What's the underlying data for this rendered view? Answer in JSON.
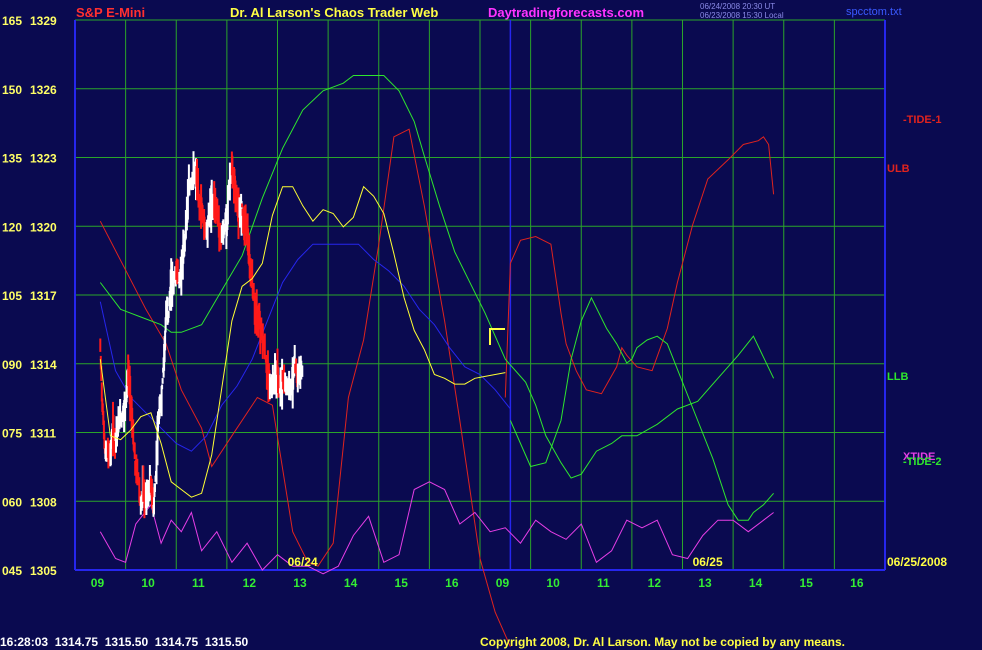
{
  "header": {
    "symbol": "S&P E-Mini",
    "title": "Dr. Al Larson's Chaos Trader Web",
    "site": "Daytradingforecasts.com",
    "ts1": "06/24/2008 20:30 UT",
    "ts2": "06/23/2008 15:30 Local",
    "file": "spcctom.txt"
  },
  "footer": {
    "quote": "16:28:03  1314.75  1315.50  1314.75  1315.50",
    "copyright": "Copyright 2008, Dr. Al Larson. May not be copied by any means."
  },
  "colors": {
    "bg": "#0a0a50",
    "grid": "#2aa52a",
    "price": "#ffffff",
    "price_red": "#ff1a1a",
    "ma": "#ffff33",
    "red": "#e0231e",
    "green": "#2ee62e",
    "blue": "#2626ee",
    "magenta": "#e63ee6",
    "yellow": "#ffff44",
    "axis_text": "#ffff66"
  },
  "chart_data": {
    "type": "line",
    "title": "S&P E-Mini",
    "y_left_osc_ticks": [
      "165",
      "150",
      "135",
      "120",
      "105",
      "090",
      "075",
      "060",
      "045"
    ],
    "y_left_price_ticks": [
      "1329",
      "1326",
      "1323",
      "1320",
      "1317",
      "1314",
      "1311",
      "1308",
      "1305"
    ],
    "ylim": [
      1305,
      1329
    ],
    "x_ticks": [
      "09",
      "10",
      "11",
      "12",
      "13",
      "14",
      "15",
      "16",
      "09",
      "10",
      "11",
      "12",
      "13",
      "14",
      "15",
      "16"
    ],
    "date_markers": [
      "06/24",
      "06/25",
      "06/25/2008"
    ],
    "right_labels": [
      "-TIDE-1",
      "ULB",
      "LLB",
      "XTIDE",
      "-TIDE-2"
    ],
    "price_series": {
      "name": "S&P E-Mini",
      "x": [
        0,
        0.5,
        1,
        1.5,
        2,
        2.5,
        3,
        3.5,
        4,
        4.5,
        5,
        5.5,
        6,
        6.5,
        7,
        7.5,
        8,
        8.5,
        9,
        9.5,
        10,
        10.5,
        11,
        11.5,
        12,
        12.5,
        13,
        13.5,
        14,
        14.5,
        15,
        15.5,
        16,
        16.5,
        17,
        17.5,
        18,
        18.5,
        19,
        19.5,
        20,
        20.5,
        21,
        21.5,
        22,
        22.5,
        23,
        23.5,
        24,
        24.5,
        25,
        25.5,
        26,
        26.5,
        27,
        27.5,
        28,
        28.5,
        29,
        29.5,
        30,
        30.5,
        31,
        31.5,
        32,
        32.5,
        33,
        33.5,
        34,
        34.5,
        35,
        35.5,
        36,
        36.5,
        37,
        37.5,
        38,
        38.5,
        39,
        39.5,
        40,
        40.5,
        41,
        41.5,
        42,
        42.5,
        43,
        43.5,
        44,
        44.5,
        45,
        45.5,
        46,
        46.5,
        47,
        47.5,
        48,
        48.5,
        49,
        49.5,
        50,
        50.5,
        51,
        51.5,
        52,
        52.5,
        53,
        53.5,
        54,
        54.5,
        55,
        55.5,
        56,
        56.5,
        57,
        57.5,
        58,
        58.5,
        59,
        59.5,
        60,
        60.5,
        61,
        61.5,
        62,
        62.5,
        63,
        63.5,
        64,
        64.5,
        65,
        65.5,
        66,
        66.5,
        67,
        67.5,
        68,
        68.5,
        69,
        69.5,
        70,
        70.5,
        71,
        71.5,
        72,
        72.5,
        73,
        73.5,
        74,
        74.5,
        75,
        75.5,
        76,
        76.5,
        77,
        77.5,
        78,
        78.5,
        79,
        79.5,
        80,
        80.5,
        81
      ],
      "values": [
        1316.5,
        1313.2,
        1311.0,
        1311.2,
        1311.1,
        1312.3,
        1312.0,
        1312.4,
        1312.8,
        1313.3,
        1313.6,
        1315.3,
        1313.8,
        1311.8,
        1310.2,
        1309.8,
        1308.4,
        1309.2,
        1308.6,
        1309.0,
        1309.4,
        1308.2,
        1310.0,
        1312.8,
        1313.6,
        1315.8,
        1318.2,
        1318.5,
        1320.0,
        1320.1,
        1320.6,
        1320.0,
        1320.7,
        1321.5,
        1323.5,
        1324.8,
        1325.4,
        1325.5,
        1325.5,
        1324.2,
        1323.9,
        1323.0,
        1322.8,
        1323.6,
        1324.2,
        1324.3,
        1323.8,
        1322.9,
        1322.5,
        1322.6,
        1323.5,
        1325.2,
        1325.7,
        1325.3,
        1324.0,
        1323.4,
        1324.0,
        1323.2,
        1323.1,
        1320.5,
        1320.0,
        1318.8,
        1318.2,
        1317.8,
        1317.2,
        1316.3,
        1315.2,
        1314.6,
        1314.6,
        1315.0,
        1315.3,
        1314.4,
        1315.0,
        1314.5,
        1314.6,
        1314.7,
        1314.9,
        1315.5,
        1315.2,
        1315.3,
        1315.5
      ]
    },
    "series": [
      {
        "name": "-TIDE-1",
        "color": "#e0231e",
        "x": [
          0,
          9,
          13,
          16,
          20,
          22,
          26,
          31,
          34,
          38,
          41,
          43,
          46,
          49,
          52,
          55,
          58,
          61,
          64,
          68,
          71,
          75,
          78,
          81
        ],
        "values": [
          136,
          113,
          104,
          92,
          82,
          72,
          80,
          90,
          88,
          55,
          47,
          46,
          52,
          90,
          105,
          130,
          158,
          160,
          140,
          110,
          84,
          48,
          34,
          25
        ]
      },
      {
        "name": "ULB",
        "color": "#e0231e",
        "x": [
          80,
          81,
          83,
          86,
          89,
          91,
          92,
          94,
          96,
          99,
          102,
          103,
          104,
          106,
          109,
          112,
          114,
          117,
          120,
          124,
          127,
          130,
          131,
          132,
          133
        ],
        "values": [
          90,
          125,
          131,
          132,
          130,
          112,
          104,
          97,
          92,
          91,
          98,
          103,
          101,
          98,
          97,
          108,
          120,
          135,
          147,
          152,
          156,
          157,
          158,
          156,
          143
        ]
      },
      {
        "name": "LLB",
        "color": "#2ee62e",
        "x": [
          0,
          4,
          8,
          12,
          14,
          16,
          20,
          24,
          28,
          32,
          36,
          40,
          44,
          48,
          50,
          53,
          56,
          59,
          62,
          64,
          67,
          70,
          76,
          80,
          84,
          86,
          88,
          91,
          93,
          95,
          98,
          101,
          103,
          106,
          110,
          114,
          118,
          122,
          126,
          129,
          133
        ],
        "values": [
          120,
          113,
          111,
          109,
          107,
          107,
          109,
          118,
          127,
          142,
          155,
          165,
          170,
          172,
          174,
          174,
          174,
          170,
          162,
          153,
          140,
          128,
          112,
          100,
          94,
          88,
          80,
          73,
          69,
          70,
          76,
          78,
          80,
          80,
          83,
          87,
          89,
          95,
          101,
          106,
          95
        ]
      },
      {
        "name": "-TIDE-2",
        "color": "#2ee62e",
        "x": [
          81,
          85,
          88,
          91,
          93,
          95,
          97,
          100,
          102,
          104,
          105,
          106,
          108,
          110,
          112,
          115,
          118,
          121,
          124,
          126,
          128,
          129,
          131,
          133
        ],
        "values": [
          84,
          72,
          73,
          84,
          100,
          110,
          116,
          108,
          104,
          99,
          100,
          103,
          105,
          106,
          104,
          94,
          84,
          74,
          62,
          58,
          58,
          60,
          62,
          65
        ]
      },
      {
        "name": "XTIDE",
        "color": "#e63ee6",
        "x": [
          0,
          3,
          5,
          7,
          10,
          12,
          14,
          16,
          18,
          20,
          23,
          26,
          29,
          32,
          35,
          38,
          41,
          44,
          47,
          50,
          53,
          56,
          59,
          62,
          65,
          68,
          71,
          74,
          77,
          80,
          83,
          86,
          89,
          92,
          95,
          98,
          101,
          104,
          107,
          110,
          113,
          116,
          119,
          122,
          125,
          128,
          131,
          133
        ],
        "values": [
          55,
          48,
          47,
          57,
          62,
          52,
          58,
          55,
          60,
          50,
          55,
          47,
          52,
          45,
          49,
          46,
          46,
          44,
          46,
          54,
          59,
          47,
          49,
          66,
          68,
          66,
          57,
          60,
          55,
          56,
          52,
          58,
          55,
          53,
          57,
          47,
          50,
          58,
          56,
          58,
          49,
          48,
          54,
          58,
          58,
          55,
          58,
          60
        ]
      },
      {
        "name": "blue",
        "color": "#2626ee",
        "x": [
          0,
          3,
          6,
          9,
          12,
          15,
          18,
          21,
          24,
          27,
          30,
          33,
          36,
          39,
          42,
          45,
          48,
          51,
          54,
          57,
          60,
          63,
          66,
          69,
          72,
          75,
          78,
          81
        ],
        "values": [
          115,
          97,
          90,
          86,
          82,
          78,
          76,
          80,
          88,
          93,
          100,
          110,
          120,
          126,
          130,
          130,
          130,
          130,
          126,
          123,
          119,
          113,
          109,
          103,
          98,
          96,
          92,
          87
        ]
      }
    ],
    "ma_series": {
      "name": "ma",
      "x": [
        0,
        2,
        4,
        6,
        8,
        10,
        12,
        14,
        16,
        18,
        20,
        22,
        24,
        26,
        28,
        30,
        32,
        34,
        36,
        38,
        40,
        42,
        44,
        46,
        48,
        50,
        52,
        54,
        56,
        58,
        60,
        62,
        64,
        66,
        68,
        70,
        72,
        74,
        76,
        78,
        80
      ],
      "values": [
        1316.0,
        1312.0,
        1311.8,
        1312.3,
        1313.0,
        1313.2,
        1311.6,
        1309.6,
        1309.2,
        1308.8,
        1309.0,
        1311.0,
        1314.5,
        1318.0,
        1319.8,
        1320.2,
        1321.0,
        1323.5,
        1325.0,
        1325.0,
        1324.0,
        1323.2,
        1323.8,
        1323.6,
        1322.9,
        1323.4,
        1325.0,
        1324.5,
        1323.6,
        1321.5,
        1319.2,
        1317.5,
        1316.5,
        1315.2,
        1315.0,
        1314.7,
        1314.7,
        1315.0,
        1315.1,
        1315.2,
        1315.3
      ]
    }
  }
}
